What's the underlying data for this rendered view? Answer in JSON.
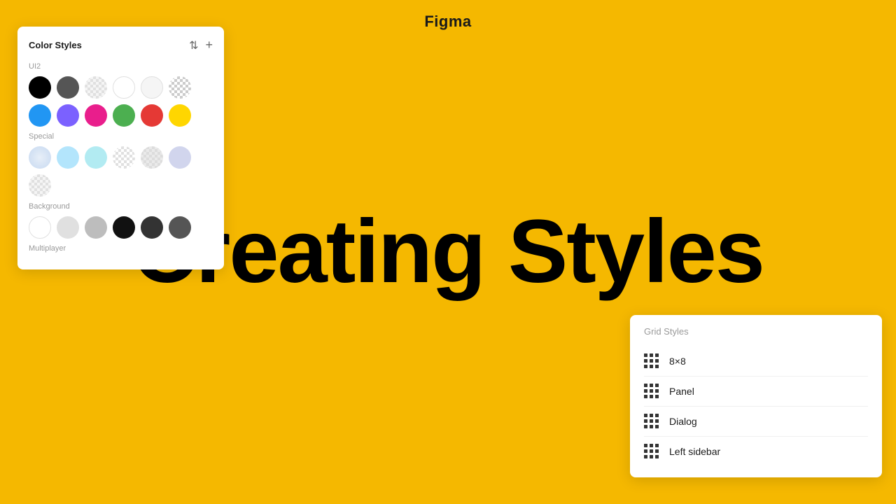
{
  "header": {
    "title": "Figma"
  },
  "headline": {
    "text": "Creating Styles"
  },
  "color_panel": {
    "title": "Color Styles",
    "filter_icon": "⇅",
    "add_icon": "+",
    "sections": [
      {
        "label": "UI2",
        "rows": [
          [
            {
              "type": "solid",
              "color": "#000000"
            },
            {
              "type": "solid",
              "color": "#555555"
            },
            {
              "type": "checker-light",
              "color": null
            },
            {
              "type": "solid",
              "color": "#ffffff",
              "border": "#e0e0e0"
            },
            {
              "type": "solid",
              "color": "#f5f5f5",
              "border": "#e0e0e0"
            },
            {
              "type": "checker",
              "color": null
            }
          ],
          [
            {
              "type": "solid",
              "color": "#2196F3"
            },
            {
              "type": "solid",
              "color": "#7B61FF"
            },
            {
              "type": "solid",
              "color": "#E91E8C"
            },
            {
              "type": "solid",
              "color": "#4CAF50"
            },
            {
              "type": "solid",
              "color": "#E53935"
            },
            {
              "type": "solid",
              "color": "#FFD600"
            }
          ]
        ]
      },
      {
        "label": "Special",
        "rows": [
          [
            {
              "type": "checker-blue",
              "color": null
            },
            {
              "type": "solid",
              "color": "#B3E5FC"
            },
            {
              "type": "solid",
              "color": "#B2EBF2"
            },
            {
              "type": "checker-gray",
              "color": null
            },
            {
              "type": "checker-dark",
              "color": null
            },
            {
              "type": "solid",
              "color": "#C5CAE9",
              "opacity": 0.5
            }
          ],
          [
            {
              "type": "checker-sm",
              "color": null
            }
          ]
        ]
      },
      {
        "label": "Background",
        "rows": [
          [
            {
              "type": "solid",
              "color": "#ffffff",
              "border": "#e0e0e0"
            },
            {
              "type": "solid",
              "color": "#e0e0e0"
            },
            {
              "type": "solid",
              "color": "#bdbdbd"
            },
            {
              "type": "solid",
              "color": "#111111"
            },
            {
              "type": "solid",
              "color": "#333333"
            },
            {
              "type": "solid",
              "color": "#555555"
            }
          ]
        ]
      },
      {
        "label": "Multiplayer"
      }
    ]
  },
  "grid_panel": {
    "title": "Grid Styles",
    "items": [
      {
        "label": "8×8"
      },
      {
        "label": "Panel"
      },
      {
        "label": "Dialog"
      },
      {
        "label": "Left sidebar"
      }
    ]
  }
}
